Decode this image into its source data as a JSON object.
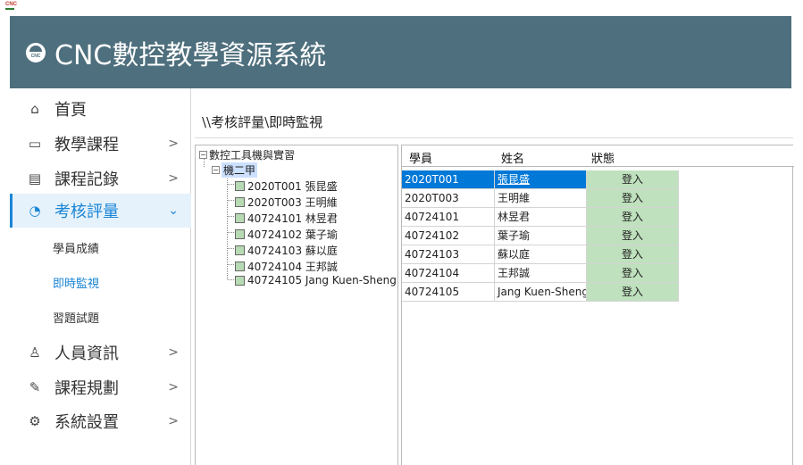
{
  "window": {
    "icon_label": "CNC"
  },
  "header": {
    "title": "CNC數控教學資源系統"
  },
  "sidebar": {
    "items": [
      {
        "label": "首頁",
        "icon": "home-icon",
        "glyph": "⌂",
        "chevron": ""
      },
      {
        "label": "教學課程",
        "icon": "course-icon",
        "glyph": "▭",
        "chevron": ">"
      },
      {
        "label": "課程記錄",
        "icon": "document-icon",
        "glyph": "▤",
        "chevron": ">"
      },
      {
        "label": "考核評量",
        "icon": "pie-chart-icon",
        "glyph": "◔",
        "chevron": "⌄"
      },
      {
        "label": "人員資訊",
        "icon": "person-icon",
        "glyph": "♙",
        "chevron": ">"
      },
      {
        "label": "課程規劃",
        "icon": "pencil-icon",
        "glyph": "✎",
        "chevron": ">"
      },
      {
        "label": "系統設置",
        "icon": "gear-icon",
        "glyph": "⚙",
        "chevron": ">"
      }
    ],
    "sub_items": [
      {
        "label": "學員成績"
      },
      {
        "label": "即時監視"
      },
      {
        "label": "習題試題"
      }
    ]
  },
  "breadcrumb": "\\\\考核評量\\即時監視",
  "tree": {
    "root": "數控工具機與實習",
    "group": "機二甲",
    "students": [
      "2020T001 張昆盛",
      "2020T003 王明維",
      "40724101 林昱君",
      "40724102 葉子瑜",
      "40724103 蘇以庭",
      "40724104 王邦誠",
      "40724105 Jang Kuen-Sheng"
    ]
  },
  "grid": {
    "headers": [
      "學員",
      "姓名",
      "狀態"
    ],
    "rows": [
      {
        "id": "2020T001",
        "name": "張昆盛",
        "status": "登入"
      },
      {
        "id": "2020T003",
        "name": "王明維",
        "status": "登入"
      },
      {
        "id": "40724101",
        "name": "林昱君",
        "status": "登入"
      },
      {
        "id": "40724102",
        "name": "葉子瑜",
        "status": "登入"
      },
      {
        "id": "40724103",
        "name": "蘇以庭",
        "status": "登入"
      },
      {
        "id": "40724104",
        "name": "王邦誠",
        "status": "登入"
      },
      {
        "id": "40724105",
        "name": "Jang Kuen-Sheng",
        "status": "登入"
      }
    ]
  },
  "colors": {
    "header_bg": "#4e6f7d",
    "accent": "#1a85d6",
    "status_ok": "#bfe1bd",
    "selection": "#0078d7"
  }
}
